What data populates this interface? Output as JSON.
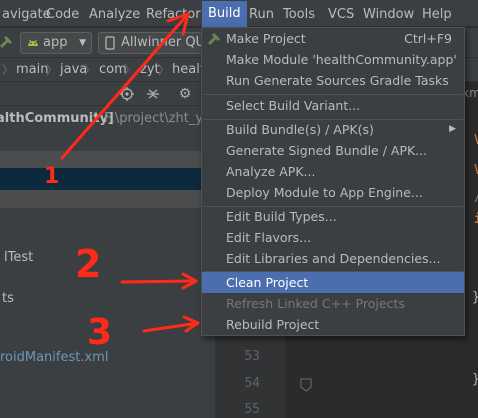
{
  "menubar": {
    "items": [
      "avigate",
      "Code",
      "Analyze",
      "Refactor",
      "Build",
      "Run",
      "Tools",
      "VCS",
      "Window",
      "Help"
    ],
    "active": "Build"
  },
  "toolbar": {
    "module": "app",
    "device": "Allwinner QU"
  },
  "breadcrumb": [
    "main",
    "java",
    "com",
    "zyt",
    "healt"
  ],
  "project": {
    "root_label": "althCommunity]",
    "root_path": "F:\\project\\zht_ytk",
    "test_item": "lTest",
    "item_ts": "ts",
    "manifest": "roidManifest.xml"
  },
  "editor": {
    "line_numbers": [
      "53",
      "54",
      "55"
    ],
    "tab_fragment": "xm",
    "code_fragments": [
      "V",
      "V",
      "/",
      "i",
      "}",
      "}"
    ]
  },
  "build_menu": {
    "items": [
      {
        "label": "Make Project",
        "shortcut": "Ctrl+F9"
      },
      {
        "label": "Make Module 'healthCommunity.app'",
        "shortcut": ""
      },
      {
        "label": "Run Generate Sources Gradle Tasks",
        "shortcut": ""
      },
      {
        "label": "Select Build Variant...",
        "shortcut": ""
      },
      {
        "label": "Build Bundle(s) / APK(s)",
        "shortcut": ""
      },
      {
        "label": "Generate Signed Bundle / APK...",
        "shortcut": ""
      },
      {
        "label": "Analyze APK...",
        "shortcut": ""
      },
      {
        "label": "Deploy Module to App Engine...",
        "shortcut": ""
      },
      {
        "label": "Edit Build Types...",
        "shortcut": ""
      },
      {
        "label": "Edit Flavors...",
        "shortcut": ""
      },
      {
        "label": "Edit Libraries and Dependencies...",
        "shortcut": ""
      },
      {
        "label": "Clean Project",
        "shortcut": ""
      },
      {
        "label": "Refresh Linked C++ Projects",
        "shortcut": ""
      },
      {
        "label": "Rebuild Project",
        "shortcut": ""
      }
    ],
    "selected_item": "Clean Project",
    "disabled_item": "Refresh Linked C++ Projects"
  },
  "annotations": {
    "labels": [
      "1",
      "2",
      "3"
    ],
    "color": "#ff2a1a"
  },
  "colors": {
    "accent": "#4b6eaf",
    "menu_bg": "#3c3f41",
    "editor_bg": "#2b2b2b",
    "make_icon": "#6a8759"
  }
}
